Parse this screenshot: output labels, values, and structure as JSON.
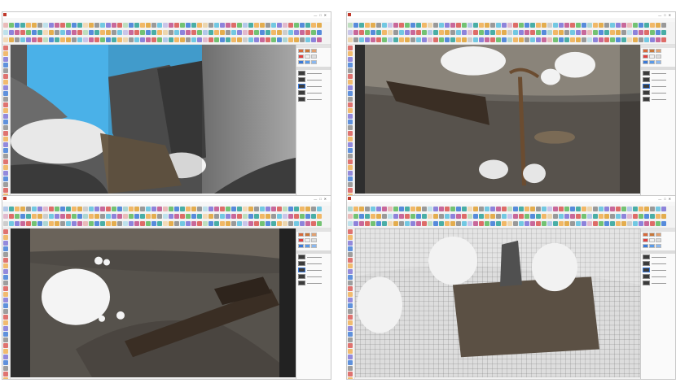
{
  "app": {
    "menu_items": [],
    "colors": {
      "ui_bg": "#f0f0f0",
      "tray_bg": "#fafafa",
      "selection": "#3a78d6",
      "sky": "#4ab1e8",
      "rock": "#4a4a4a",
      "ground": "#5a554f",
      "snow": "#f2f2f2"
    }
  },
  "panes": [
    {
      "name": "sketchup-window-top-left",
      "scene": "rock-arch-sky"
    },
    {
      "name": "sketchup-window-top-right",
      "scene": "log-and-skulls"
    },
    {
      "name": "sketchup-window-bottom-left",
      "scene": "fallen-log-snow"
    },
    {
      "name": "sketchup-window-bottom-right",
      "scene": "wireframe-terrain"
    }
  ],
  "icons": {
    "toolbar": "tool-icon",
    "left_tools": "tool-icon",
    "window_controls": "window-controls-icon"
  }
}
